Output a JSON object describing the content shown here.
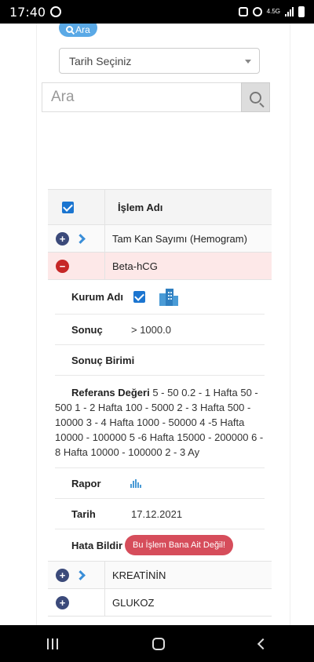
{
  "status_bar": {
    "time": "17:40",
    "network": "4.5G"
  },
  "search": {
    "ara_button": "Ara",
    "date_select": "Tarih Seçiniz",
    "placeholder": "Ara"
  },
  "table": {
    "header": "İşlem Adı",
    "rows": [
      {
        "name": "Tam Kan Sayımı (Hemogram)",
        "state": "collapsed"
      },
      {
        "name": "Beta-hCG",
        "state": "expanded"
      },
      {
        "name": "KREATİNİN",
        "state": "collapsed"
      },
      {
        "name": "GLUKOZ",
        "state": "collapsed"
      }
    ]
  },
  "detail": {
    "kurum_label": "Kurum Adı",
    "sonuc_label": "Sonuç",
    "sonuc_value": "> 1000.0",
    "birim_label": "Sonuç Birimi",
    "referans_label": "Referans Değeri",
    "referans_value": "5 - 50 0.2 - 1 Hafta 50 - 500 1 - 2 Hafta 100 - 5000 2 - 3 Hafta 500 - 10000 3 - 4 Hafta 1000 - 50000 4 -5 Hafta 10000 - 100000 5 -6 Hafta 15000 - 200000 6 - 8 Hafta 10000 - 100000 2 - 3 Ay",
    "rapor_label": "Rapor",
    "tarih_label": "Tarih",
    "tarih_value": "17.12.2021",
    "hata_label": "Hata Bildir",
    "hata_button": "Bu İşlem Bana Ait Değil!"
  },
  "colors": {
    "accent_blue": "#1b75d0",
    "expanded_row_bg": "#fde8e8",
    "error_button": "#d64d5b",
    "expand_button": "#3b4a7a",
    "collapse_button": "#c62828"
  }
}
